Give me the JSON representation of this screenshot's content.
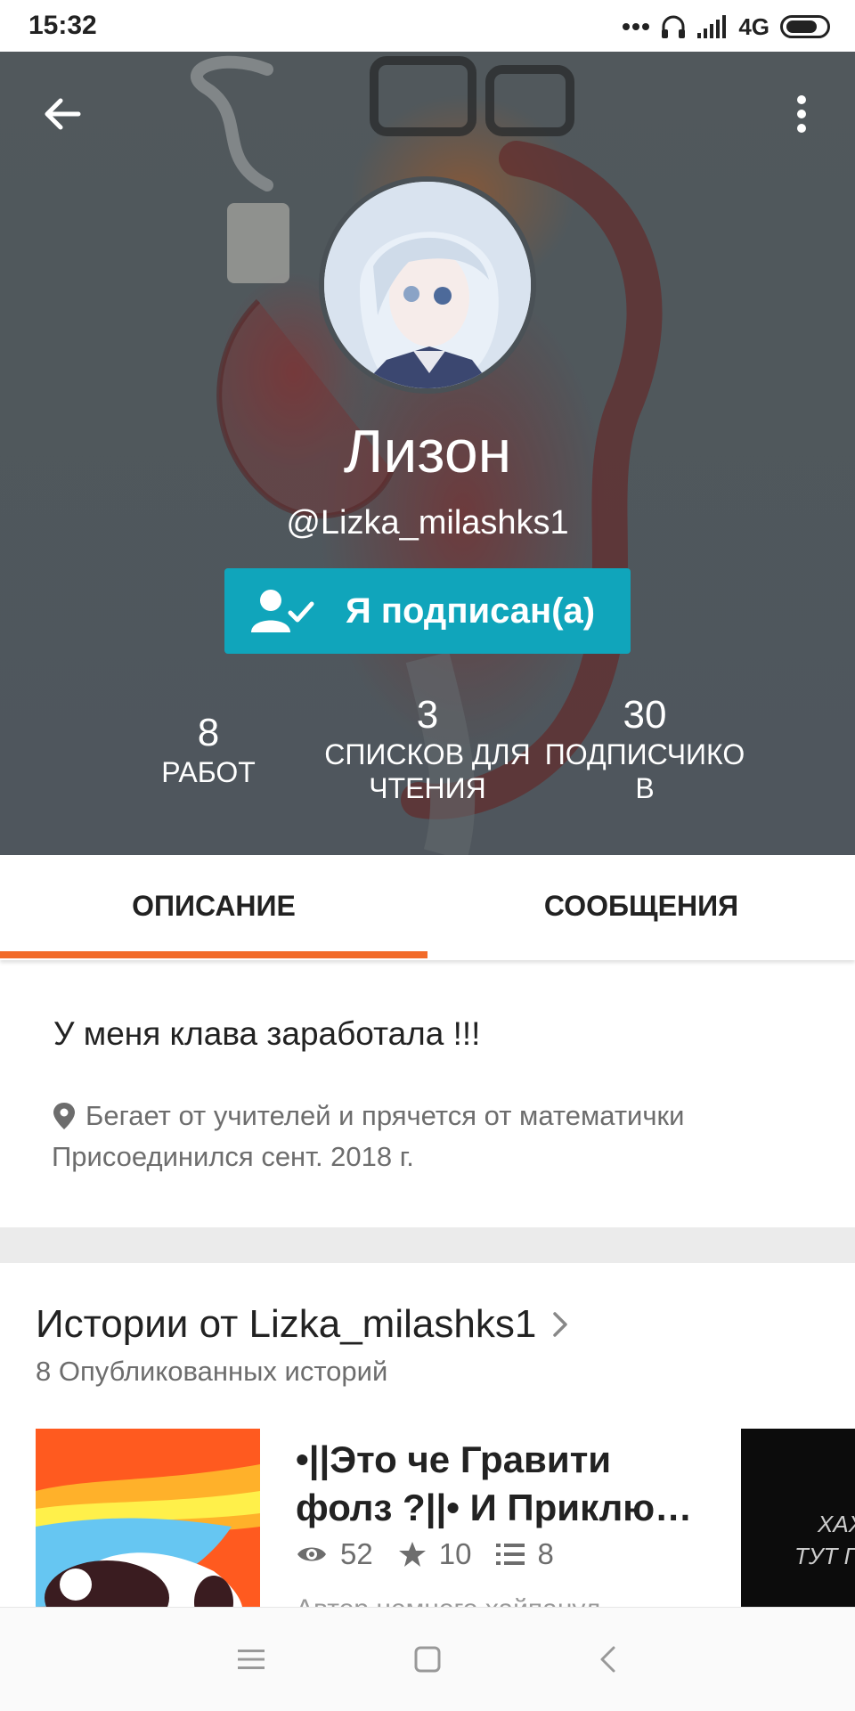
{
  "status_bar": {
    "time": "15:32",
    "network": "4G"
  },
  "profile": {
    "name": "Лизон",
    "handle": "@Lizka_milashks1",
    "follow_label": "Я подписан(а)",
    "stats": [
      {
        "value": "8",
        "label_line1": "РАБОТ",
        "label_line2": ""
      },
      {
        "value": "3",
        "label_line1": "СПИСКОВ ДЛЯ",
        "label_line2": "ЧТЕНИЯ"
      },
      {
        "value": "30",
        "label_line1": "ПОДПИСЧИКО",
        "label_line2": "В"
      }
    ]
  },
  "tabs": [
    {
      "label": "ОПИСАНИЕ",
      "active": true
    },
    {
      "label": "СООБЩЕНИЯ",
      "active": false
    }
  ],
  "about": {
    "description": "У меня клава заработала !!!",
    "location": "Бегает от учителей и прячется от математички",
    "joined": "Присоединился сент. 2018 г."
  },
  "stories": {
    "title": "Истории от Lizka_milashks1",
    "subtitle": "8 Опубликованных историй",
    "items": [
      {
        "title": "•||Это че Гравити фолз ?||• И Приклю…",
        "views": "52",
        "votes": "10",
        "parts": "8",
        "snippet": "Автор немного хайпанул"
      }
    ],
    "next_cover_text_line1": "ХАХ",
    "next_cover_text_line2": "ТУТ П"
  },
  "colors": {
    "accent": "#f26b2a",
    "follow_button": "#10a5bb"
  },
  "icons": {
    "back": "arrow-left-icon",
    "more": "vertical-dots-icon",
    "follow": "user-check-icon",
    "location": "map-pin-icon",
    "chevron": "chevron-right-icon",
    "views": "eye-icon",
    "votes": "star-icon",
    "parts": "list-icon"
  }
}
